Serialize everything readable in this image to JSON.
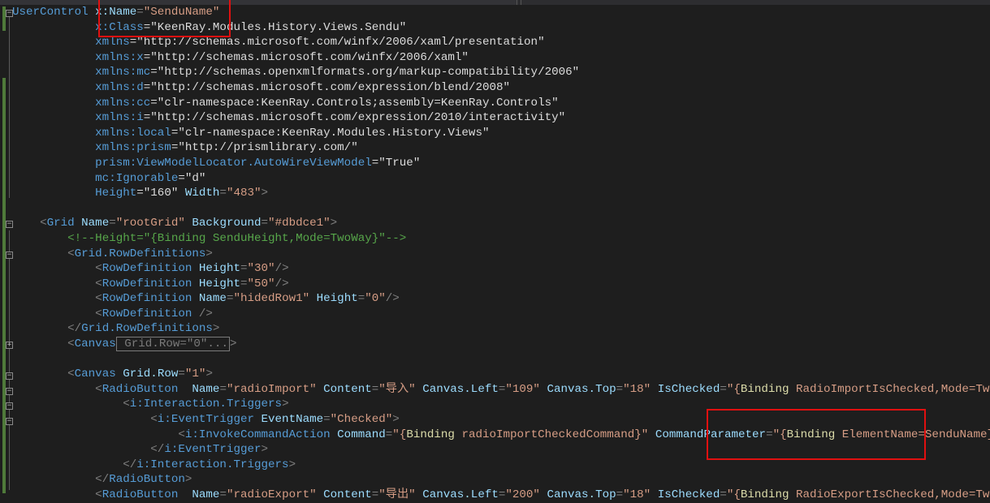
{
  "code_lines": [
    "UserControl x:Name=\"SenduName\"",
    "            x:Class=\"KeenRay.Modules.History.Views.Sendu\"",
    "            xmlns=\"http://schemas.microsoft.com/winfx/2006/xaml/presentation\"",
    "            xmlns:x=\"http://schemas.microsoft.com/winfx/2006/xaml\"",
    "            xmlns:mc=\"http://schemas.openxmlformats.org/markup-compatibility/2006\"",
    "            xmlns:d=\"http://schemas.microsoft.com/expression/blend/2008\"",
    "            xmlns:cc=\"clr-namespace:KeenRay.Controls;assembly=KeenRay.Controls\"",
    "            xmlns:i=\"http://schemas.microsoft.com/expression/2010/interactivity\"",
    "            xmlns:local=\"clr-namespace:KeenRay.Modules.History.Views\"",
    "            xmlns:prism=\"http://prismlibrary.com/\"",
    "            prism:ViewModelLocator.AutoWireViewModel=\"True\"",
    "            mc:Ignorable=\"d\"",
    "            Height=\"160\" Width=\"483\">",
    "",
    "    <Grid Name=\"rootGrid\" Background=\"#dbdce1\">",
    "        <!--Height=\"{Binding SenduHeight,Mode=TwoWay}\"-->",
    "        <Grid.RowDefinitions>",
    "            <RowDefinition Height=\"30\"/>",
    "            <RowDefinition Height=\"50\"/>",
    "            <RowDefinition Name=\"hidedRow1\" Height=\"0\"/>",
    "            <RowDefinition />",
    "        </Grid.RowDefinitions>",
    "        <Canvas Grid.Row=\"0\"...>",
    "",
    "        <Canvas Grid.Row=\"1\">",
    "            <RadioButton  Name=\"radioImport\" Content=\"导入\" Canvas.Left=\"109\" Canvas.Top=\"18\" IsChecked=\"{Binding RadioImportIsChecked,Mode=TwoWay}\">",
    "                <i:Interaction.Triggers>",
    "                    <i:EventTrigger EventName=\"Checked\">",
    "                        <i:InvokeCommandAction Command=\"{Binding radioImportCheckedCommand}\" CommandParameter=\"{Binding ElementName=SenduName}\"/>",
    "                    </i:EventTrigger>",
    "                </i:Interaction.Triggers>",
    "            </RadioButton>",
    "            <RadioButton  Name=\"radioExport\" Content=\"导出\" Canvas.Left=\"200\" Canvas.Top=\"18\" IsChecked=\"{Binding RadioExportIsChecked,Mode=TwoWay}\">"
  ],
  "colors": {
    "background": "#1e1e1e",
    "tag": "#569cd6",
    "attribute": "#9cdcfe",
    "value": "#d69d85",
    "comment": "#57a64a",
    "highlight_box": "#e01010"
  }
}
